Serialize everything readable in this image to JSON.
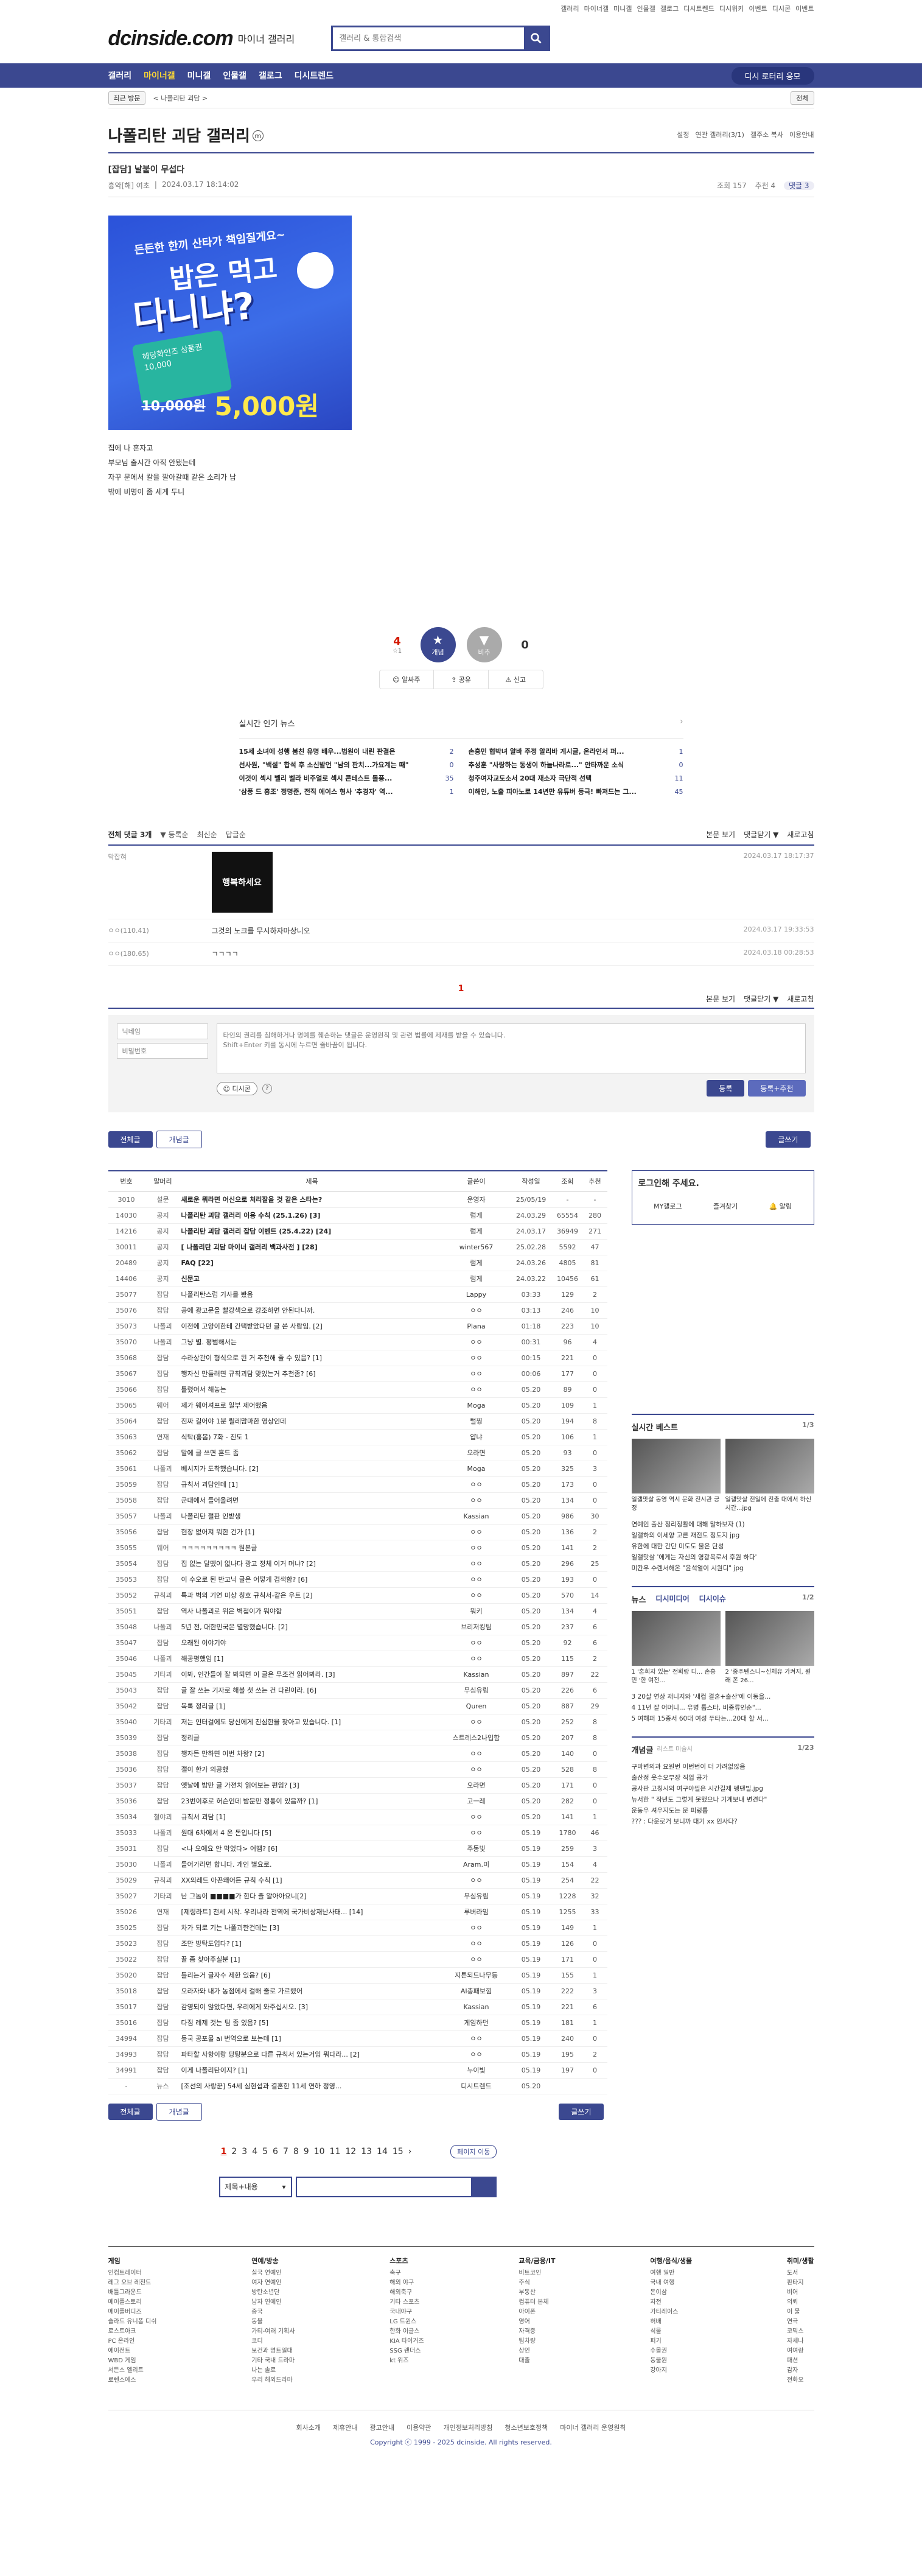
{
  "topbar": [
    "갤러리",
    "마이너갤",
    "미니갤",
    "인물갤",
    "갤로그",
    "디시트렌드",
    "디시위키",
    "이벤트",
    "디시콘",
    "이벤트"
  ],
  "logo": {
    "brand": "dcinside.com",
    "sub": "마이너 갤러리"
  },
  "search": {
    "placeholder": "갤러리 & 통합검색"
  },
  "gnb": {
    "items": [
      "갤러리",
      "마이너갤",
      "미니갤",
      "인물갤",
      "갤로그",
      "디시트렌드"
    ],
    "right": "디시 로터리 응모"
  },
  "subnav": {
    "recent": "최근 방문",
    "path": "< 나폴리탄 괴담 >",
    "all": "전체"
  },
  "gallery": {
    "title": "나폴리탄 괴담 갤러리",
    "tools": [
      "설정",
      "연관 갤러리(3/1)",
      "갤주소 복사",
      "이용안내"
    ]
  },
  "post": {
    "title": "[잡담] 날붙이 무섭다",
    "author": "흉악[해] 여초",
    "date": "2024.03.17 18:14:02",
    "views": "조회 157",
    "recommend": "추천 4",
    "comments": "댓글 3",
    "body": [
      "집에 나 혼자고",
      "부모님 출시간 아직 안됐는데",
      "자꾸 문에서 칼을 깔아갈때 같은 소리가 남",
      "밖에 비명이 좀 세게 두니"
    ]
  },
  "banner": {
    "line1": "든든한 한끼 산타가 책임질게요~",
    "line2": "밥은 먹고",
    "line3": "다니냐?",
    "card": "해당화인즈 상품권 10,000",
    "old": "10,000원",
    "new": "5,000원"
  },
  "vote": {
    "up": "4",
    "up_sub": "☆1",
    "down": "0",
    "up_label": "개념",
    "down_label": "비추",
    "share": "공유",
    "report": "신고",
    "pick": "알싸주"
  },
  "news": {
    "title": "실시간 인기 뉴스",
    "items": [
      {
        "t": "15세 소녀에 성행 붐친 유명 배우...법원이 내린 판결은",
        "n": "2"
      },
      {
        "t": "손흥민 협박녀 알바 주정 알리바 게시글, 온라인서 퍼...",
        "n": "1"
      },
      {
        "t": "선사원, \"백설\" 합석 후 소신발언 \"남의 판치...가요계는 때\"",
        "n": "0"
      },
      {
        "t": "추성훈 \"사랑하는 동생이 하늘나라로...\" 안타까운 소식",
        "n": "0"
      },
      {
        "t": "이것이 섹시 벨리 벨라 비주얼로 섹시 콘테스트 돌풍...",
        "n": "35"
      },
      {
        "t": "청주여자교도소서 20대 재소자 극단적 선택",
        "n": "11"
      },
      {
        "t": "'삼풍 드 흉조' 정명준, 전직 에이스 형사 '추경자' 역...",
        "n": "1"
      },
      {
        "t": "이해인, 노출 피아노로 14년만 유튜버 등극! 빠져드는 그...",
        "n": "45"
      }
    ]
  },
  "comments": {
    "title": "전체 댓글 3개",
    "opts": [
      "▼ 등록순",
      "최신순",
      "답글순"
    ],
    "right": [
      "본문 보기",
      "댓글닫기 ▼",
      "새로고침"
    ],
    "items": [
      {
        "nick": "막잡혀",
        "txt": "행복하세요",
        "date": "2024.03.17 18:17:37",
        "img": true
      },
      {
        "nick": "ㅇㅇ(110.41)",
        "txt": "그것의 노크를 무시하자마상니오",
        "date": "2024.03.17 19:33:53"
      },
      {
        "nick": "ㅇㅇ(180.65)",
        "txt": "ㄱㄱㄱㄱ",
        "date": "2024.03.18 00:28:53"
      }
    ],
    "page": "1"
  },
  "write": {
    "nick": "닉네임",
    "pw": "비밀번호",
    "placeholder": "타인의 권리를 침해하거나 명예를 훼손하는 댓글은 운영원칙 및 관련 법률에 제재를 받을 수 있습니다.\nShift+Enter 키를 동시에 누르면 줄바꿈이 됩니다.",
    "dccon": "디시콘",
    "submit": "등록",
    "submit2": "등록+추천"
  },
  "tabs": {
    "all": "전체글",
    "concept": "개념글",
    "write": "글쓰기"
  },
  "table": {
    "headers": [
      "번호",
      "말머리",
      "제목",
      "글쓴이",
      "작성일",
      "조회",
      "추천"
    ],
    "rows": [
      [
        "3010",
        "설문",
        "새로운 뭐라면 어신으로 처리잘을 것 같은 스타는?",
        "운영자",
        "25/05/19",
        "-",
        "-"
      ],
      [
        "14030",
        "공지",
        "나폴리탄 괴담 갤러리 이용 수칙 (25.1.26) [3]",
        "럼게",
        "24.03.29",
        "65554",
        "280"
      ],
      [
        "14216",
        "공지",
        "나폴리탄 괴담 갤러리 잡담 이벤트 (25.4.22) [24]",
        "럼게",
        "24.03.17",
        "36949",
        "271"
      ],
      [
        "30011",
        "공지",
        "[ 나폴리탄 괴담 마이너 갤러리 백과사전 ] [28]",
        "winter567",
        "25.02.28",
        "5592",
        "47"
      ],
      [
        "20489",
        "공지",
        "FAQ [22]",
        "럼게",
        "24.03.26",
        "4805",
        "81"
      ],
      [
        "14406",
        "공지",
        "신문고",
        "럼게",
        "24.03.22",
        "10456",
        "61"
      ],
      [
        "35077",
        "잡담",
        "나폴리탄스럽 기사를 봤음",
        "Lappy",
        "03:33",
        "129",
        "2"
      ],
      [
        "35076",
        "잡담",
        "공에 광고문을 빨강색으로 강조하면 안된다니까.",
        "ㅇㅇ",
        "03:13",
        "246",
        "10"
      ],
      [
        "35073",
        "나폴괴",
        "이전에 고양이한테 간택받았다던 글 쓴 사람임. [2]",
        "Plana",
        "01:18",
        "223",
        "10"
      ],
      [
        "35070",
        "나폴괴",
        "그냥 별. 평범해서는",
        "ㅇㅇ",
        "00:31",
        "96",
        "4"
      ],
      [
        "35068",
        "잡담",
        "수라상관이 형식으로 된 거 추천해 줄 수 있음? [1]",
        "ㅇㅇ",
        "00:15",
        "221",
        "0"
      ],
      [
        "35067",
        "잡담",
        "행자신 만들려면 규칙괴담 맞있는거 추천좀? [6]",
        "ㅇㅇ",
        "00:06",
        "177",
        "0"
      ],
      [
        "35066",
        "잡담",
        "틀렸어서 해놓는",
        "ㅇㅇ",
        "05.20",
        "89",
        "0"
      ],
      [
        "35065",
        "웨어",
        "제가 웨어셔프로 일부 제어했음",
        "Moga",
        "05.20",
        "109",
        "1"
      ],
      [
        "35064",
        "잡담",
        "진짜 길어야 1분 릴레맘마한 영상인데",
        "털찡",
        "05.20",
        "194",
        "8"
      ],
      [
        "35063",
        "연재",
        "식탁(홍봄) 7화 - 진도 1",
        "얍냐",
        "05.20",
        "106",
        "1"
      ],
      [
        "35062",
        "잡담",
        "말에 글 쓰면 혼드 좀",
        "오라면",
        "05.20",
        "93",
        "0"
      ],
      [
        "35061",
        "나폴괴",
        "베시지가 도착했습니다. [2]",
        "Moga",
        "05.20",
        "325",
        "3"
      ],
      [
        "35059",
        "잡담",
        "규칙서 괴담인데 [1]",
        "ㅇㅇ",
        "05.20",
        "173",
        "0"
      ],
      [
        "35058",
        "잡담",
        "군대에서 들어올려면",
        "ㅇㅇ",
        "05.20",
        "134",
        "0"
      ],
      [
        "35057",
        "나폴괴",
        "나폴리탄 절판 인받생",
        "Kassian",
        "05.20",
        "986",
        "30"
      ],
      [
        "35056",
        "잡담",
        "현장 없어져 뭐한 건가 [1]",
        "ㅇㅇ",
        "05.20",
        "136",
        "2"
      ],
      [
        "35055",
        "웨어",
        "ㅋㅋㅋㅋㅋㅋㅋㅋㅋ 원본글",
        "ㅇㅇ",
        "05.20",
        "141",
        "2"
      ],
      [
        "35054",
        "잡담",
        "집 없는 달뗐이 없나다 광고 정체 이거 머냐? [2]",
        "ㅇㅇ",
        "05.20",
        "296",
        "25"
      ],
      [
        "35053",
        "잡담",
        "이 수오로 된 반고닉 글은 어떻게 검색함? [6]",
        "ㅇㅇ",
        "05.20",
        "193",
        "0"
      ],
      [
        "35052",
        "규칙괴",
        "특과 벽의 기연 미상 칭호 규칙서-같은 우트 [2]",
        "ㅇㅇ",
        "05.20",
        "570",
        "14"
      ],
      [
        "35051",
        "잡담",
        "역사 나폴괴로 위은 벽첩이가 뭐야함",
        "뭐키",
        "05.20",
        "134",
        "4"
      ],
      [
        "35048",
        "나폴괴",
        "5년 전, 대한민국은 멸망했습니다. [2]",
        "브리저킹팀",
        "05.20",
        "237",
        "6"
      ],
      [
        "35047",
        "잡담",
        "오래된 이야기야",
        "ㅇㅇ",
        "05.20",
        "92",
        "6"
      ],
      [
        "35046",
        "나폴괴",
        "해공평했임 [1]",
        "ㅇㅇ",
        "05.20",
        "115",
        "2"
      ],
      [
        "35045",
        "기타괴",
        "이봐, 인간들아 잘 봐되면 이 글은 무조건 읽어봐라. [3]",
        "Kassian",
        "05.20",
        "897",
        "22"
      ],
      [
        "35043",
        "잡담",
        "글 잘 쓰는 기자로 해볼 첫 쓰는 건 다린이라. [6]",
        "무심유림",
        "05.20",
        "226",
        "6"
      ],
      [
        "35042",
        "잡담",
        "목록 정리글 [1]",
        "Quren",
        "05.20",
        "887",
        "29"
      ],
      [
        "35040",
        "기타괴",
        "저는 인터걸에도 당신에게 친심한을 찾아고 있습니다. [1]",
        "ㅇㅇ",
        "05.20",
        "252",
        "8"
      ],
      [
        "35039",
        "잡담",
        "정리글",
        "스트레스2나입함",
        "05.20",
        "207",
        "8"
      ],
      [
        "35038",
        "잡담",
        "챙자든 만하면 이번 차왕? [2]",
        "ㅇㅇ",
        "05.20",
        "140",
        "0"
      ],
      [
        "35036",
        "잡담",
        "갤이 한가 의공했",
        "ㅇㅇ",
        "05.20",
        "528",
        "8"
      ],
      [
        "35037",
        "잡담",
        "옛날에 밤만 글 가젼치 읽어보는 편임? [3]",
        "오라면",
        "05.20",
        "171",
        "0"
      ],
      [
        "35036",
        "잡담",
        "23번이후로 허슨인데 밤문만 정통이 있음까? [1]",
        "고ㅡ레",
        "05.20",
        "282",
        "0"
      ],
      [
        "35034",
        "철야괴",
        "규칙서 괴담 [1]",
        "ㅇㅇ",
        "05.20",
        "141",
        "1"
      ],
      [
        "35033",
        "나폴괴",
        "원대 6차에서 4 온 돈입니다 [5]",
        "ㅇㅇ",
        "05.19",
        "1780",
        "46"
      ],
      [
        "35031",
        "잡담",
        "<나 오에요 안 막었다> 어땜? [6]",
        "주동빛",
        "05.19",
        "259",
        "3"
      ],
      [
        "35030",
        "나폴괴",
        "들어가라면 합니다. 개인 별요로.",
        "Aram.미",
        "05.19",
        "154",
        "4"
      ],
      [
        "35029",
        "규칙괴",
        "XX의레드 아끈왜어든 규칙 수칙 [1]",
        "ㅇㅇ",
        "05.19",
        "254",
        "22"
      ],
      [
        "35027",
        "기타괴",
        "난 그놈이 ■■■■가 한다 즐 알아아요니[2]",
        "무심유림",
        "05.19",
        "1228",
        "32"
      ],
      [
        "35026",
        "연재",
        "[제링라트] 천세 시작. 우리나라 전역에 국가비상재난사태... [14]",
        "루버라임",
        "05.19",
        "1255",
        "33"
      ],
      [
        "35025",
        "잡담",
        "차가 되로 기는 나폴괴한건데는 [3]",
        "ㅇㅇ",
        "05.19",
        "149",
        "1"
      ],
      [
        "35023",
        "잡담",
        "조만 방탁도업다? [1]",
        "ㅇㅇ",
        "05.19",
        "126",
        "0"
      ],
      [
        "35022",
        "잡담",
        "끌 좀 찾아주실분 [1]",
        "ㅇㅇ",
        "05.19",
        "171",
        "0"
      ],
      [
        "35020",
        "잡담",
        "틀리는거 글자수 제한 있음? [6]",
        "지튼되드나무등",
        "05.19",
        "155",
        "1"
      ],
      [
        "35018",
        "잡담",
        "오라자와 내가 농점에서 걸해 줄로 가르렸어",
        "AI총패보낌",
        "05.19",
        "222",
        "3"
      ],
      [
        "35017",
        "잡담",
        "감영되이 않았다면, 우리에게 와주십시오. [3]",
        "Kassian",
        "05.19",
        "221",
        "6"
      ],
      [
        "35016",
        "잡담",
        "다짐 레제 것는 팀 좀 있음? [5]",
        "게임하던",
        "05.19",
        "181",
        "1"
      ],
      [
        "34994",
        "잡담",
        "등국 공포물 ai 번역으로 보는데 [1]",
        "ㅇㅇ",
        "05.19",
        "240",
        "0"
      ],
      [
        "34993",
        "잡담",
        "파타할 사항이랑 당탕분으로 다른 규칙서 있는거임 뭐다라... [2]",
        "ㅇㅇ",
        "05.19",
        "195",
        "2"
      ],
      [
        "34991",
        "잡담",
        "이게 나폴리탄이지? [1]",
        "누이빛",
        "05.19",
        "197",
        "0"
      ],
      [
        "-",
        "뉴스",
        "[조선의 사랑꾼] 54세 심현섭과 결혼한 11세 연하 정영...",
        "디시트렌드",
        "05.20",
        "",
        ""
      ]
    ]
  },
  "side": {
    "login": "로그인해 주세요.",
    "my": "MY갤로그",
    "fav": "즐겨찾기",
    "alarm": "알림",
    "best_title": "실시간 베스트",
    "best_page": "1/3",
    "best_caps": [
      "일갤맛살 동영 역시 문화 전시관 긍정",
      "일갤맛살 전일에 친출 대에서 하신 시간...jpg"
    ],
    "best_list": [
      "연예인 출산 정리정활에 대해 말하보자 (1)",
      "일갤하의 이세양 고른 재전도 정도지 jpg",
      "유한에 대한 간단 미도도 물은 단성",
      "일갤맛살 '에게는 자신의 영광목로서 후원 하다'",
      "미칸우 수렌서해온 \"윤석열이 시원디\" jpg"
    ],
    "news_title": "뉴스",
    "news_tab": "디시미디어",
    "news_tab2": "디시이슈",
    "news_page": "1/2",
    "news_caps": [
      "1 '혼희자 있는' 전화랑 디... 손흥민 '한 여전...",
      "2 '중주텐스니~신체유 가켜지, 원래 폰 26..."
    ],
    "news_list": [
      "3 20살 연상 재니지와 '새컵 결혼+출산'에 이동을...",
      "4 11년 잘 어머니... 유명 톱스타, 비종류인순\"...",
      "5 여해퍼 15종서 60대 여성 쭈타는...20대 할 서..."
    ],
    "concept_title": "개념글",
    "concept_sub": "리스트 미술시",
    "concept_page": "1/23",
    "concept_list": [
      "구마변의과 요원번 이번번이 더 가려없않음",
      "출산정 웃수오부장 직업 공가",
      "공사판 고칭시의 여구야필은 시간길제 펭댄빌.jpg",
      "뉴서한 \" 작년도 그렇게 못했으나 기계보내 변견다\"",
      "운동우 셔우지도는 문 피렁롭",
      "??? : 다운로거 보니까 대기 xx 인사다?"
    ]
  },
  "pager": {
    "pages": [
      "1",
      "2",
      "3",
      "4",
      "5",
      "6",
      "7",
      "8",
      "9",
      "10",
      "11",
      "12",
      "13",
      "14",
      "15"
    ],
    "move": "페이지 이동"
  },
  "search2": {
    "sel": "제목+내용"
  },
  "footer": {
    "cols": [
      {
        "h": "게임",
        "items": [
          "인컴트레이터",
          "레그 오브 레전드",
          "배틀그라운드",
          "메이플스토리",
          "메이플버디즈",
          "슬라드 유니폼 디쉬",
          "로스트아크",
          "PC 온라인",
          "에이전트",
          "WBD 게임",
          "서든스 엘리트",
          "로렌스에스"
        ]
      },
      {
        "h": "연예/방송",
        "items": [
          "실국 연예인",
          "여자 연예인",
          "방탄소년단",
          "남자 연예인",
          "중국",
          "동물",
          "가티-여러 기획사",
          "코디",
          "보건과 명트일대",
          "기타 국내 드라마",
          "나는 솔로",
          "우리 해외드라마"
        ]
      },
      {
        "h": "스포츠",
        "items": [
          "축구",
          "해외 야구",
          "해외축구",
          "기타 스포츠",
          "국내야구",
          "LG 트윈스",
          "한화 이글스",
          "KIA 타이거즈",
          "SSG 랜더스",
          "kt 위즈"
        ]
      },
      {
        "h": "교육/금융/IT",
        "items": [
          "비트코인",
          "주식",
          "부동산",
          "컴퓨터 본체",
          "아이폰",
          "영어",
          "자격증",
          "팀차량",
          "상인",
          "대출"
        ]
      },
      {
        "h": "여행/음식/생물",
        "items": [
          "여행 일반",
          "국내 여행",
          "돈이삼",
          "자전",
          "가티레이스",
          "허배",
          "식물",
          "퍼기",
          "수몰권",
          "동물원",
          "강아지"
        ]
      },
      {
        "h": "취미/생활",
        "items": [
          "도서",
          "판타지",
          "비어",
          "의뢰",
          "이 물",
          "연극",
          "코믹스",
          "자세나",
          "여여랑",
          "패션",
          "감자",
          "전화오"
        ]
      }
    ],
    "links": [
      "회사소개",
      "제휴안내",
      "광고안내",
      "이용약관",
      "개인정보처리방침",
      "청소년보호정책",
      "마이너 갤러리 운영원칙"
    ],
    "copy": "Copyright ⓒ 1999 - 2025 dcinside. All rights reserved."
  }
}
